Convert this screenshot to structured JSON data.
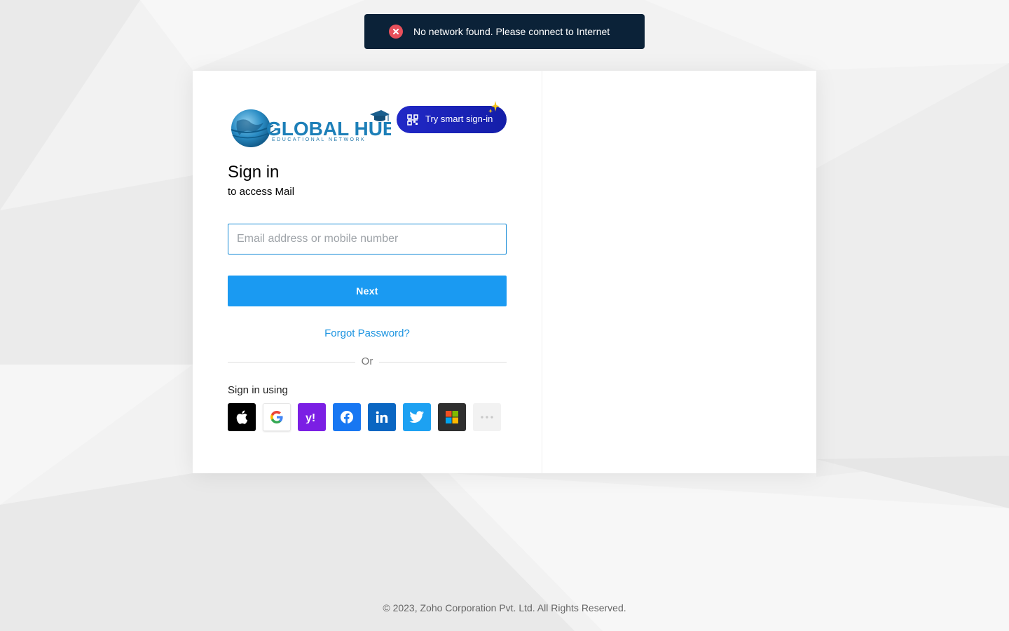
{
  "toast": {
    "message": "No network found. Please connect to Internet",
    "color": "#0b2238",
    "icon": "error-x-icon"
  },
  "logo": {
    "title": "GLOBAL HUB",
    "subtitle": "EDUCATIONAL NETWORK"
  },
  "smart_signin": {
    "label": "Try smart sign-in",
    "icon": "qr-icon"
  },
  "signin": {
    "title": "Sign in",
    "subtitle": "to access Mail",
    "email_placeholder": "Email address or mobile number",
    "email_value": "",
    "next_label": "Next",
    "forgot_label": "Forgot Password?",
    "or_label": "Or",
    "sign_in_using": "Sign in using"
  },
  "providers": [
    {
      "name": "apple",
      "icon": "apple-icon",
      "color": "#000000"
    },
    {
      "name": "google",
      "icon": "google-icon",
      "color": "#ffffff"
    },
    {
      "name": "yahoo",
      "icon": "yahoo-icon",
      "color": "#7b1fe4"
    },
    {
      "name": "facebook",
      "icon": "facebook-icon",
      "color": "#1877f2"
    },
    {
      "name": "linkedin",
      "icon": "linkedin-icon",
      "color": "#0a66c2"
    },
    {
      "name": "twitter",
      "icon": "twitter-icon",
      "color": "#1da1f2"
    },
    {
      "name": "microsoft",
      "icon": "microsoft-icon",
      "color": "#2f2f2f"
    },
    {
      "name": "more",
      "icon": "more-dots-icon",
      "color": "#f2f2f2"
    }
  ],
  "colors": {
    "accent": "#1a9af2",
    "link": "#1a93e0",
    "smart_button": "#1a22b8"
  },
  "footer": {
    "text": "© 2023, Zoho Corporation Pvt. Ltd. All Rights Reserved."
  }
}
